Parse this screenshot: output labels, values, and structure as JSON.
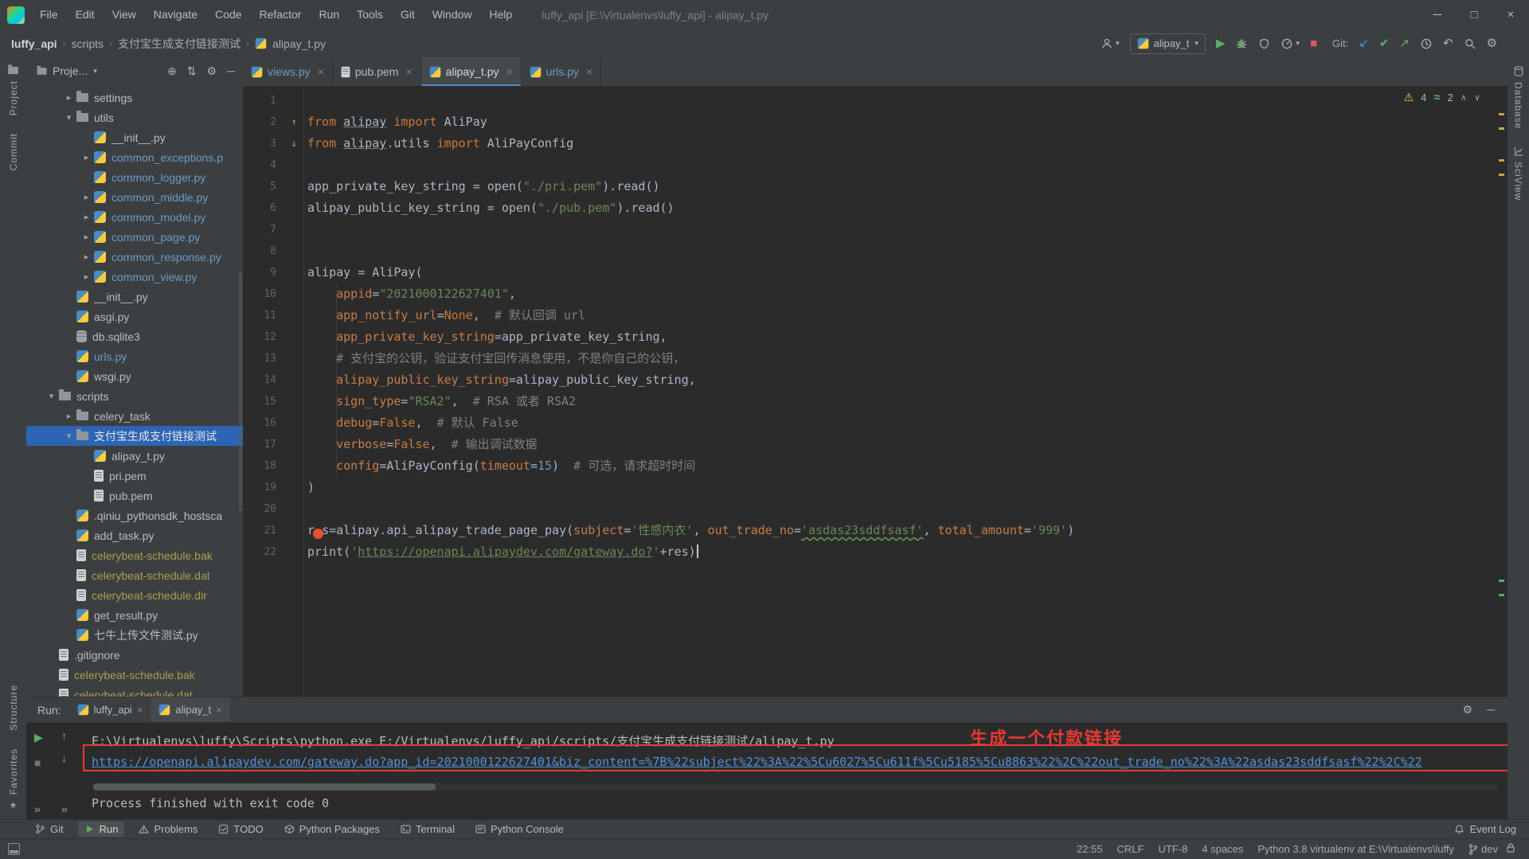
{
  "titlebar": {
    "menus": [
      "File",
      "Edit",
      "View",
      "Navigate",
      "Code",
      "Refactor",
      "Run",
      "Tools",
      "Git",
      "Window",
      "Help"
    ],
    "title": "luffy_api [E:\\Virtualenvs\\luffy_api] - alipay_t.py",
    "window_controls": {
      "minimize": "─",
      "maximize": "□",
      "close": "×"
    }
  },
  "navbar": {
    "breadcrumbs": [
      "luffy_api",
      "scripts",
      "支付宝生成支付链接测试",
      "alipay_t.py"
    ],
    "run_config": "alipay_t",
    "git_label": "Git:"
  },
  "left_stripe": {
    "project": "Project",
    "commit": "Commit",
    "structure": "Structure",
    "favorites": "Favorites"
  },
  "right_stripe": {
    "database": "Database",
    "sciview": "SciView"
  },
  "project_panel": {
    "title": "Proje...",
    "tree": [
      {
        "d": 2,
        "chev": "r",
        "icon": "folder",
        "label": "settings"
      },
      {
        "d": 2,
        "chev": "d",
        "icon": "folder",
        "label": "utils"
      },
      {
        "d": 3,
        "icon": "py",
        "label": "__init__.py"
      },
      {
        "d": 3,
        "chev": "r",
        "icon": "py",
        "label": "common_exceptions.p",
        "color": "mod"
      },
      {
        "d": 3,
        "icon": "py",
        "label": "common_logger.py",
        "color": "mod"
      },
      {
        "d": 3,
        "chev": "r",
        "icon": "py",
        "label": "common_middle.py",
        "color": "mod"
      },
      {
        "d": 3,
        "chev": "r",
        "icon": "py",
        "label": "common_model.py",
        "color": "mod"
      },
      {
        "d": 3,
        "chev": "r",
        "icon": "py",
        "label": "common_page.py",
        "color": "mod"
      },
      {
        "d": 3,
        "chev": "r",
        "icon": "py",
        "label": "common_response.py",
        "color": "mod"
      },
      {
        "d": 3,
        "chev": "r",
        "icon": "py",
        "label": "common_view.py",
        "color": "mod"
      },
      {
        "d": 2,
        "icon": "py",
        "label": "__init__.py"
      },
      {
        "d": 2,
        "icon": "py",
        "label": "asgi.py"
      },
      {
        "d": 2,
        "icon": "db",
        "label": "db.sqlite3"
      },
      {
        "d": 2,
        "icon": "py",
        "label": "urls.py",
        "color": "mod"
      },
      {
        "d": 2,
        "icon": "py",
        "label": "wsgi.py"
      },
      {
        "d": 1,
        "chev": "d",
        "icon": "folder",
        "label": "scripts"
      },
      {
        "d": 2,
        "chev": "r",
        "icon": "folder",
        "label": "celery_task"
      },
      {
        "d": 2,
        "chev": "d",
        "icon": "folder",
        "label": "支付宝生成支付链接测试",
        "selected": true
      },
      {
        "d": 3,
        "icon": "py",
        "label": "alipay_t.py"
      },
      {
        "d": 3,
        "icon": "txt",
        "label": "pri.pem"
      },
      {
        "d": 3,
        "icon": "txt",
        "label": "pub.pem"
      },
      {
        "d": 2,
        "icon": "py",
        "label": ".qiniu_pythonsdk_hostsca"
      },
      {
        "d": 2,
        "icon": "py",
        "label": "add_task.py"
      },
      {
        "d": 2,
        "icon": "txt",
        "label": "celerybeat-schedule.bak",
        "color": "ign"
      },
      {
        "d": 2,
        "icon": "txt",
        "label": "celerybeat-schedule.dat",
        "color": "ign"
      },
      {
        "d": 2,
        "icon": "txt",
        "label": "celerybeat-schedule.dir",
        "color": "ign"
      },
      {
        "d": 2,
        "icon": "py",
        "label": "get_result.py"
      },
      {
        "d": 2,
        "icon": "py",
        "label": "七牛上传文件测试.py"
      },
      {
        "d": 1,
        "icon": "txt",
        "label": ".gitignore"
      },
      {
        "d": 1,
        "icon": "txt",
        "label": "celerybeat-schedule.bak",
        "color": "ign"
      },
      {
        "d": 1,
        "icon": "txt",
        "label": "celerybeat-schedule.dat",
        "color": "ign"
      }
    ]
  },
  "editor": {
    "tabs": [
      {
        "label": "views.py",
        "icon": "py",
        "color": "mod"
      },
      {
        "label": "pub.pem",
        "icon": "txt"
      },
      {
        "label": "alipay_t.py",
        "icon": "py",
        "active": true
      },
      {
        "label": "urls.py",
        "icon": "py",
        "color": "mod"
      }
    ],
    "inspections": {
      "warnings": "4",
      "typos": "2"
    },
    "lines": [
      {
        "n": 1,
        "seg": []
      },
      {
        "n": 2,
        "mark": "up",
        "seg": [
          {
            "t": "from ",
            "c": "k"
          },
          {
            "t": "alipay",
            "c": "ul"
          },
          {
            "t": " ",
            "c": "p"
          },
          {
            "t": "import ",
            "c": "k"
          },
          {
            "t": "AliPay",
            "c": "p"
          }
        ]
      },
      {
        "n": 3,
        "mark": "down",
        "seg": [
          {
            "t": "from ",
            "c": "k"
          },
          {
            "t": "alipay",
            "c": "ul"
          },
          {
            "t": ".utils ",
            "c": "p"
          },
          {
            "t": "import ",
            "c": "k"
          },
          {
            "t": "AliPayConfig",
            "c": "p"
          }
        ]
      },
      {
        "n": 4,
        "seg": []
      },
      {
        "n": 5,
        "seg": [
          {
            "t": "app_private_key_string = open(",
            "c": "p"
          },
          {
            "t": "\"./pri.pem\"",
            "c": "s"
          },
          {
            "t": ").read()",
            "c": "p"
          }
        ]
      },
      {
        "n": 6,
        "seg": [
          {
            "t": "alipay_public_key_string = open(",
            "c": "p"
          },
          {
            "t": "\"./pub.pem\"",
            "c": "s"
          },
          {
            "t": ").read()",
            "c": "p"
          }
        ]
      },
      {
        "n": 7,
        "seg": []
      },
      {
        "n": 8,
        "seg": []
      },
      {
        "n": 9,
        "seg": [
          {
            "t": "alipay = AliPay(",
            "c": "p"
          }
        ]
      },
      {
        "n": 10,
        "seg": [
          {
            "t": "    ",
            "c": "p"
          },
          {
            "t": "appid",
            "c": "a"
          },
          {
            "t": "=",
            "c": "p"
          },
          {
            "t": "\"2021000122627401\"",
            "c": "s"
          },
          {
            "t": ",",
            "c": "p"
          }
        ]
      },
      {
        "n": 11,
        "seg": [
          {
            "t": "    ",
            "c": "p"
          },
          {
            "t": "app_notify_url",
            "c": "a"
          },
          {
            "t": "=",
            "c": "p"
          },
          {
            "t": "None",
            "c": "k"
          },
          {
            "t": ",  ",
            "c": "p"
          },
          {
            "t": "# 默认回调 url",
            "c": "c"
          }
        ]
      },
      {
        "n": 12,
        "seg": [
          {
            "t": "    ",
            "c": "p"
          },
          {
            "t": "app_private_key_string",
            "c": "a"
          },
          {
            "t": "=app_private_key_string,",
            "c": "p"
          }
        ]
      },
      {
        "n": 13,
        "seg": [
          {
            "t": "    ",
            "c": "p"
          },
          {
            "t": "# 支付宝的公钥，验证支付宝回传消息使用，不是你自己的公钥，",
            "c": "c"
          }
        ]
      },
      {
        "n": 14,
        "seg": [
          {
            "t": "    ",
            "c": "p"
          },
          {
            "t": "alipay_public_key_string",
            "c": "a"
          },
          {
            "t": "=alipay_public_key_string,",
            "c": "p"
          }
        ]
      },
      {
        "n": 15,
        "seg": [
          {
            "t": "    ",
            "c": "p"
          },
          {
            "t": "sign_type",
            "c": "a"
          },
          {
            "t": "=",
            "c": "p"
          },
          {
            "t": "\"RSA2\"",
            "c": "s"
          },
          {
            "t": ",  ",
            "c": "p"
          },
          {
            "t": "# RSA 或者 RSA2",
            "c": "c"
          }
        ]
      },
      {
        "n": 16,
        "seg": [
          {
            "t": "    ",
            "c": "p"
          },
          {
            "t": "debug",
            "c": "a"
          },
          {
            "t": "=",
            "c": "p"
          },
          {
            "t": "False",
            "c": "k"
          },
          {
            "t": ",  ",
            "c": "p"
          },
          {
            "t": "# 默认 False",
            "c": "c"
          }
        ]
      },
      {
        "n": 17,
        "seg": [
          {
            "t": "    ",
            "c": "p"
          },
          {
            "t": "verbose",
            "c": "a"
          },
          {
            "t": "=",
            "c": "p"
          },
          {
            "t": "False",
            "c": "k"
          },
          {
            "t": ",  ",
            "c": "p"
          },
          {
            "t": "# 输出调试数据",
            "c": "c"
          }
        ]
      },
      {
        "n": 18,
        "seg": [
          {
            "t": "    ",
            "c": "p"
          },
          {
            "t": "config",
            "c": "a"
          },
          {
            "t": "=AliPayConfig(",
            "c": "p"
          },
          {
            "t": "timeout",
            "c": "a"
          },
          {
            "t": "=",
            "c": "p"
          },
          {
            "t": "15",
            "c": "n"
          },
          {
            "t": ")  ",
            "c": "p"
          },
          {
            "t": "# 可选，请求超时时间",
            "c": "c"
          }
        ]
      },
      {
        "n": 19,
        "seg": [
          {
            "t": ")",
            "c": "p"
          }
        ]
      },
      {
        "n": 20,
        "seg": []
      },
      {
        "n": 21,
        "seg": [
          {
            "t": "r",
            "c": "p"
          },
          {
            "t": "e",
            "c": "dot"
          },
          {
            "t": "s=alipay.api_alipay_trade_page_pay(",
            "c": "p"
          },
          {
            "t": "subject",
            "c": "a"
          },
          {
            "t": "=",
            "c": "p"
          },
          {
            "t": "'性感内衣'",
            "c": "s"
          },
          {
            "t": ", ",
            "c": "p"
          },
          {
            "t": "out_trade_no",
            "c": "a"
          },
          {
            "t": "=",
            "c": "p"
          },
          {
            "t": "'asdas23sddfsasf'",
            "c": "st"
          },
          {
            "t": ", ",
            "c": "p"
          },
          {
            "t": "total_amount",
            "c": "a"
          },
          {
            "t": "=",
            "c": "p"
          },
          {
            "t": "'999'",
            "c": "s"
          },
          {
            "t": ")",
            "c": "p"
          }
        ]
      },
      {
        "n": 22,
        "caret": true,
        "seg": [
          {
            "t": "print",
            "c": "p"
          },
          {
            "t": "(",
            "c": "p"
          },
          {
            "t": "'",
            "c": "s"
          },
          {
            "t": "https://openapi.alipaydev.com/gateway.do?",
            "c": "su"
          },
          {
            "t": "'",
            "c": "s"
          },
          {
            "t": "+res",
            "c": "p"
          },
          {
            "t": ")",
            "c": "p"
          }
        ]
      }
    ]
  },
  "run_panel": {
    "label": "Run:",
    "tabs": [
      {
        "label": "luffy_api"
      },
      {
        "label": "alipay_t",
        "active": true
      }
    ],
    "console": {
      "command": "E:\\Virtualenvs\\luffy\\Scripts\\python.exe E:/Virtualenvs/luffy_api/scripts/支付宝生成支付链接测试/alipay_t.py",
      "link": "https://openapi.alipaydev.com/gateway.do?app_id=2021000122627401&biz_content=%7B%22subject%22%3A%22%5Cu6027%5Cu611f%5Cu5185%5Cu8863%22%2C%22out_trade_no%22%3A%22asdas23sddfsasf%22%2C%22",
      "exit": "Process finished with exit code 0"
    },
    "annotation": "生成一个付款链接"
  },
  "bottom_bar": {
    "tabs": [
      {
        "label": "Git",
        "icon": "git"
      },
      {
        "label": "Run",
        "icon": "run",
        "active": true
      },
      {
        "label": "Problems",
        "icon": "problems"
      },
      {
        "label": "TODO",
        "icon": "todo"
      },
      {
        "label": "Python Packages",
        "icon": "package"
      },
      {
        "label": "Terminal",
        "icon": "terminal"
      },
      {
        "label": "Python Console",
        "icon": "pyconsole"
      }
    ],
    "event_log": "Event Log"
  },
  "status_bar": {
    "items": [
      "22:55",
      "CRLF",
      "UTF-8",
      "4 spaces",
      "Python 3.8 virtualenv at E:\\Virtualenvs\\luffy"
    ],
    "branch": "dev"
  }
}
